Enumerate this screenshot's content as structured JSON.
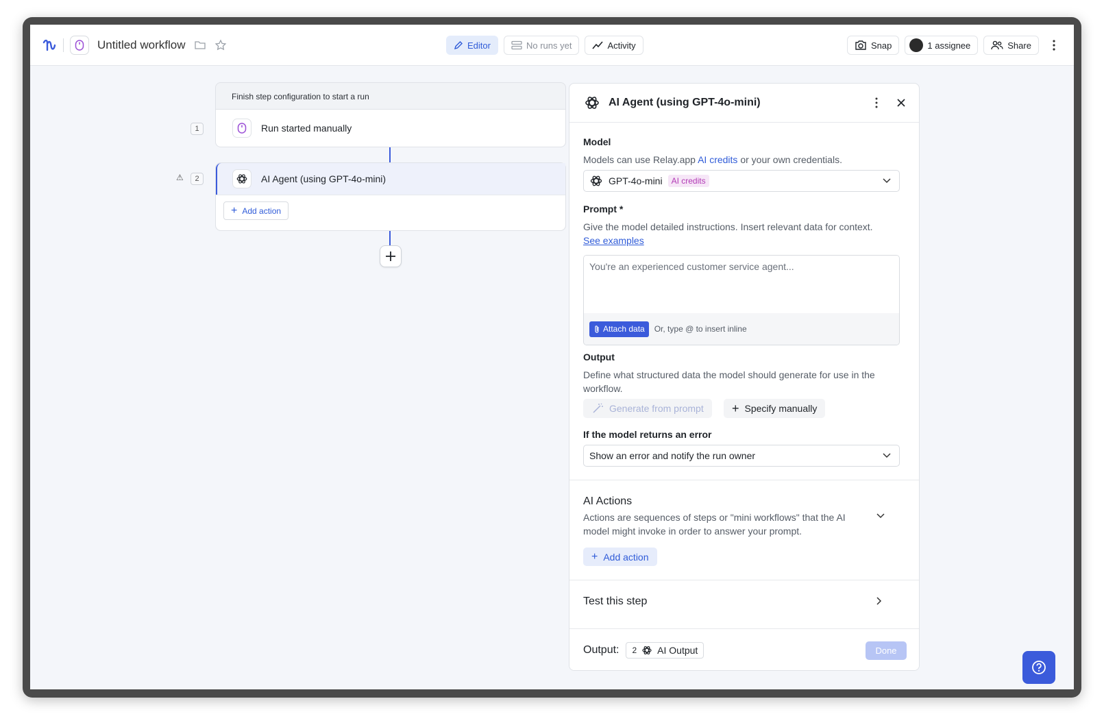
{
  "header": {
    "title": "Untitled workflow",
    "editor_label": "Editor",
    "runs_label": "No runs yet",
    "activity_label": "Activity",
    "snap_label": "Snap",
    "assignee_label": "1 assignee",
    "share_label": "Share"
  },
  "canvas": {
    "banner": "Finish step configuration to start a run",
    "step1": {
      "num": "1",
      "label": "Run started manually"
    },
    "step2": {
      "num": "2",
      "label": "AI Agent (using GPT-4o-mini)",
      "warning": "⚠"
    },
    "add_action_label": "Add action"
  },
  "panel": {
    "title": "AI Agent (using GPT-4o-mini)",
    "model": {
      "label": "Model",
      "hint_prefix": "Models can use Relay.app",
      "hint_link": "AI credits",
      "hint_suffix": "or your own credentials.",
      "selected": "GPT-4o-mini",
      "badge": "AI credits"
    },
    "prompt": {
      "label": "Prompt *",
      "hint": "Give the model detailed instructions. Insert relevant data for context.",
      "examples_link": "See examples",
      "placeholder": "You're an experienced customer service agent...",
      "attach_label": "Attach data",
      "inline_hint": "Or, type @ to insert inline"
    },
    "output": {
      "label": "Output",
      "hint": "Define what structured data the model should generate for use in the workflow.",
      "generate_label": "Generate from prompt",
      "manual_label": "Specify manually"
    },
    "error": {
      "label": "If the model returns an error",
      "selected": "Show an error and notify the run owner"
    },
    "ai_actions": {
      "title": "AI Actions",
      "hint": "Actions are sequences of steps or \"mini workflows\" that the AI model might invoke in order to answer your prompt.",
      "add_label": "Add action"
    },
    "test_label": "Test this step",
    "footer": {
      "output_label": "Output:",
      "tag_num": "2",
      "tag_label": "AI Output",
      "done_label": "Done"
    }
  },
  "colors": {
    "accent": "#3b5bdb",
    "badge_bg": "#f6e6f7",
    "badge_text": "#b23ab5"
  }
}
